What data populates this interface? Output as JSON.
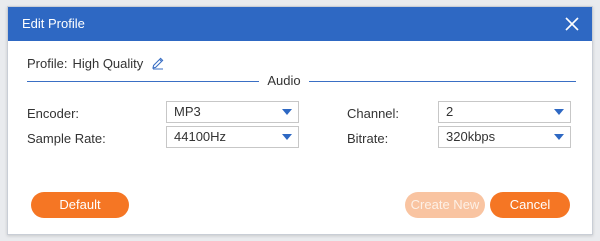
{
  "dialog": {
    "title": "Edit Profile",
    "close_icon": "close-icon"
  },
  "profile": {
    "label": "Profile:",
    "value": "High Quality",
    "edit_icon": "pencil-edit-icon"
  },
  "audio": {
    "section_title": "Audio",
    "encoder": {
      "label": "Encoder:",
      "value": "MP3"
    },
    "sample_rate": {
      "label": "Sample Rate:",
      "value": "44100Hz"
    },
    "channel": {
      "label": "Channel:",
      "value": "2"
    },
    "bitrate": {
      "label": "Bitrate:",
      "value": "320kbps"
    }
  },
  "buttons": {
    "default_label": "Default",
    "create_new_label": "Create New",
    "cancel_label": "Cancel"
  },
  "colors": {
    "titlebar": "#2e68c3",
    "accent_orange": "#f57624",
    "disabled_orange": "#f9c4a1",
    "section_line": "#3a6fc4"
  }
}
